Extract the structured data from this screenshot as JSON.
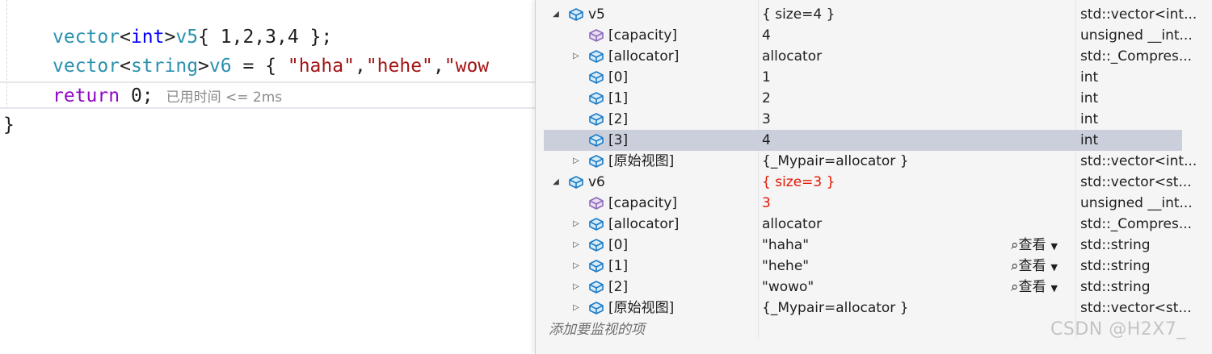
{
  "editor": {
    "line1": {
      "type": "vector",
      "lt": "<",
      "template_arg": "int",
      "gt": ">",
      "ident": "v5",
      "rest": "{ 1,2,3,4 };"
    },
    "line2": {
      "type": "vector",
      "lt": "<",
      "template_arg": "string",
      "gt": ">",
      "ident": "v6",
      "rest": " = { ",
      "str1": "\"haha\"",
      "comma1": ",",
      "str2": "\"hehe\"",
      "comma2": ",",
      "str3": "\"wow"
    },
    "line3": {
      "keyword": "return",
      "rest": " 0;",
      "elapsed_hint": "已用时间 <= 2ms"
    },
    "closing_brace": "}"
  },
  "watch": {
    "rows": [
      {
        "expander": "◢",
        "name": "v5",
        "value": "{ size=4 }",
        "type": "std::vector<int...",
        "icon": "field-icon",
        "changed": false
      },
      {
        "expander": "",
        "name": "[capacity]",
        "value": "4",
        "type": "unsigned __int...",
        "icon": "property-icon",
        "changed": false
      },
      {
        "expander": "▷",
        "name": "[allocator]",
        "value": "allocator",
        "type": "std::_Compres...",
        "icon": "field-icon",
        "changed": false
      },
      {
        "expander": "",
        "name": "[0]",
        "value": "1",
        "type": "int",
        "icon": "field-icon",
        "changed": false
      },
      {
        "expander": "",
        "name": "[1]",
        "value": "2",
        "type": "int",
        "icon": "field-icon",
        "changed": false
      },
      {
        "expander": "",
        "name": "[2]",
        "value": "3",
        "type": "int",
        "icon": "field-icon",
        "changed": false
      },
      {
        "expander": "",
        "name": "[3]",
        "value": "4",
        "type": "int",
        "icon": "field-icon",
        "changed": false,
        "selected": true
      },
      {
        "expander": "▷",
        "name": "[原始视图]",
        "value": "{_Mypair=allocator }",
        "type": "std::vector<int...",
        "icon": "field-icon",
        "changed": false
      },
      {
        "expander": "◢",
        "name": "v6",
        "value": "{ size=3 }",
        "type": "std::vector<st...",
        "icon": "field-icon",
        "changed": true
      },
      {
        "expander": "",
        "name": "[capacity]",
        "value": "3",
        "type": "unsigned __int...",
        "icon": "property-icon",
        "changed": true
      },
      {
        "expander": "▷",
        "name": "[allocator]",
        "value": "allocator",
        "type": "std::_Compres...",
        "icon": "field-icon",
        "changed": false
      },
      {
        "expander": "▷",
        "name": "[0]",
        "value": "\"haha\"",
        "type": "std::string",
        "icon": "field-icon",
        "changed": false,
        "viewer": "查看"
      },
      {
        "expander": "▷",
        "name": "[1]",
        "value": "\"hehe\"",
        "type": "std::string",
        "icon": "field-icon",
        "changed": false,
        "viewer": "查看"
      },
      {
        "expander": "▷",
        "name": "[2]",
        "value": "\"wowo\"",
        "type": "std::string",
        "icon": "field-icon",
        "changed": false,
        "viewer": "查看"
      },
      {
        "expander": "▷",
        "name": "[原始视图]",
        "value": "{_Mypair=allocator }",
        "type": "std::vector<st...",
        "icon": "field-icon",
        "changed": false
      }
    ],
    "add_watch_placeholder": "添加要监视的项"
  },
  "watermark": "CSDN @H2X7_",
  "colors": {
    "keyword": "#0000ff",
    "type": "#2b91af",
    "string": "#a31515",
    "return_keyword": "#8f08c4",
    "changed_value": "#e51400",
    "selection": "#cbcfdc",
    "icon_blue": "#1e7bc4",
    "icon_purple": "#8e6bb8"
  }
}
